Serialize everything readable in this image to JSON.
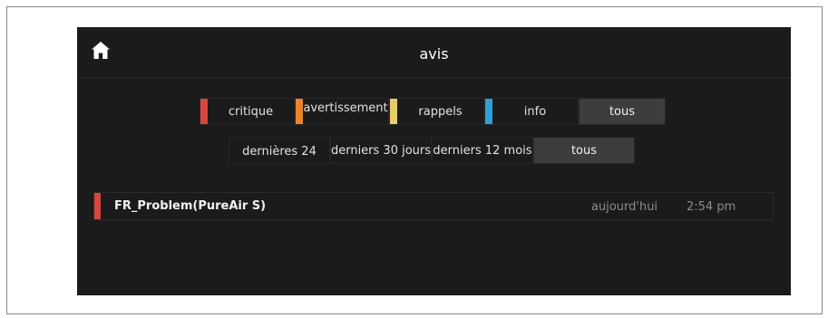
{
  "header": {
    "title": "avis",
    "home_icon": "home-icon"
  },
  "severity_filters": [
    {
      "label": "critique",
      "color": "#d9453f"
    },
    {
      "label": "avertissement",
      "color": "#e8852c"
    },
    {
      "label": "rappels",
      "color": "#e8cc6a"
    },
    {
      "label": "info",
      "color": "#2f9fd8"
    },
    {
      "label": "tous",
      "color": ""
    }
  ],
  "severity_selected": "tous",
  "period_filters": [
    {
      "label": "dernières 24"
    },
    {
      "label": "derniers 30 jours"
    },
    {
      "label": "derniers 12 mois"
    },
    {
      "label": "tous"
    }
  ],
  "period_selected": "tous",
  "notifications": [
    {
      "name": "FR_Problem(PureAir S)",
      "date": "aujourd'hui",
      "time": "2:54 pm",
      "severity_color": "#d9453f"
    }
  ],
  "colors": {
    "screen_bg": "#1b1b1b",
    "active_chip_bg": "#3d3d3d"
  }
}
